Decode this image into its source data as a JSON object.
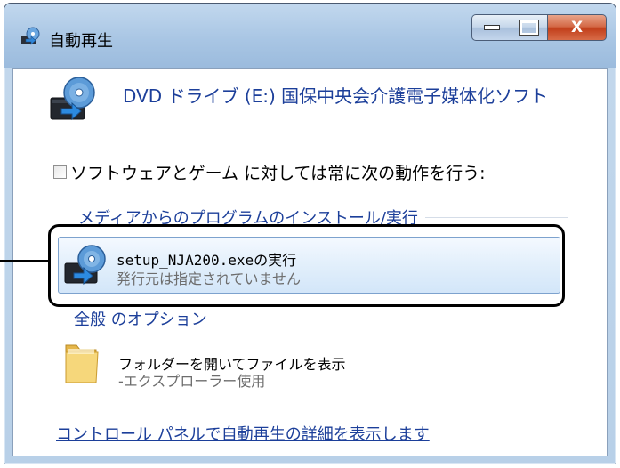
{
  "window": {
    "title": "自動再生",
    "close_label": "X"
  },
  "device": {
    "title": "DVD ドライブ (E:) 国保中央会介護電子媒体化ソフト"
  },
  "always_option": {
    "label": "ソフトウェアとゲーム に対しては常に次の動作を行う:",
    "checked": false
  },
  "media_section": {
    "header": "メディアからのプログラムのインストール/実行",
    "items": [
      {
        "main": "setup_NJA200.exeの実行",
        "sub": "発行元は指定されていません",
        "icon": "dvd-install-icon"
      }
    ]
  },
  "general_section": {
    "header": "全般 のオプション",
    "items": [
      {
        "main": "フォルダーを開いてファイルを表示",
        "sub": "-エクスプローラー使用",
        "icon": "folder-icon"
      }
    ]
  },
  "footer": {
    "link": "コントロール パネルで自動再生の詳細を表示します"
  },
  "colors": {
    "link": "#1c3f9a",
    "subtext": "#6d6d6d",
    "highlight_border": "#000000"
  }
}
